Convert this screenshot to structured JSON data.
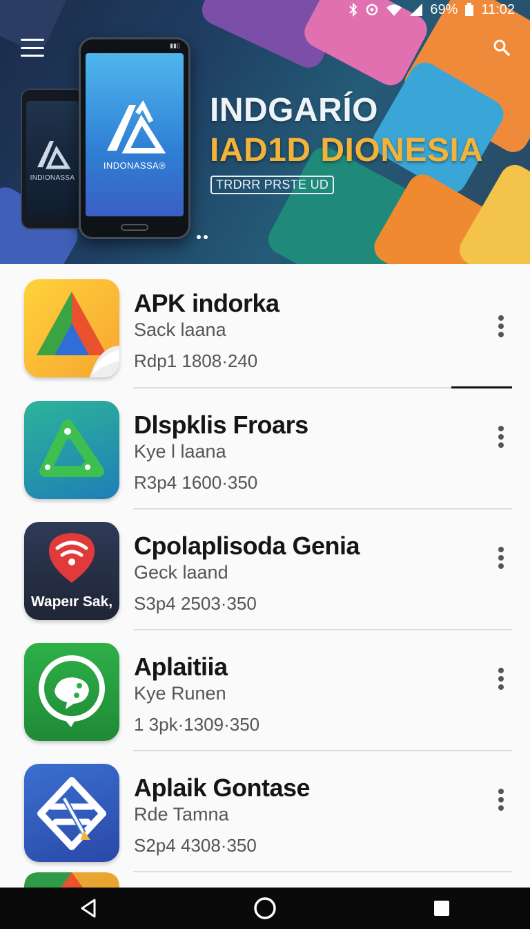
{
  "status_bar": {
    "battery": "69%",
    "time": "11:02"
  },
  "banner": {
    "title_line1": "INDGARÍO",
    "title_line2": "IAD1D DIONESIA",
    "badge": "TRDRR PRSTE UD",
    "phone_front_label": "INDONASSA®",
    "phone_back_label": "INDIONASSA"
  },
  "apps": [
    {
      "name": "APK indorka",
      "subtitle": "Sack laana",
      "meta": "Rdp1 1808·240",
      "icon": "pinwheel-app-icon"
    },
    {
      "name": "Dlspklis Froars",
      "subtitle": "Kye l laana",
      "meta": "R3p4 1600·350",
      "icon": "share-triangle-app-icon"
    },
    {
      "name": "Cpolaplisoda Genia",
      "subtitle": "Geck laand",
      "meta": "S3p4 2503·350",
      "icon": "wifi-pin-app-icon",
      "icon_text": "Wapeır Sak,"
    },
    {
      "name": "Aplaitiia",
      "subtitle": "Kye Runen",
      "meta": "1 3pk·1309·350",
      "icon": "chat-bubble-app-icon"
    },
    {
      "name": "Aplaik Gontase",
      "subtitle": "Rde Tamna",
      "meta": "S2p4 4308·350",
      "icon": "diamond-knot-app-icon"
    }
  ],
  "colors": {
    "banner_accent": "#f2b33a",
    "list_background": "#fafafa",
    "nav_bar": "#0a0a0a"
  }
}
